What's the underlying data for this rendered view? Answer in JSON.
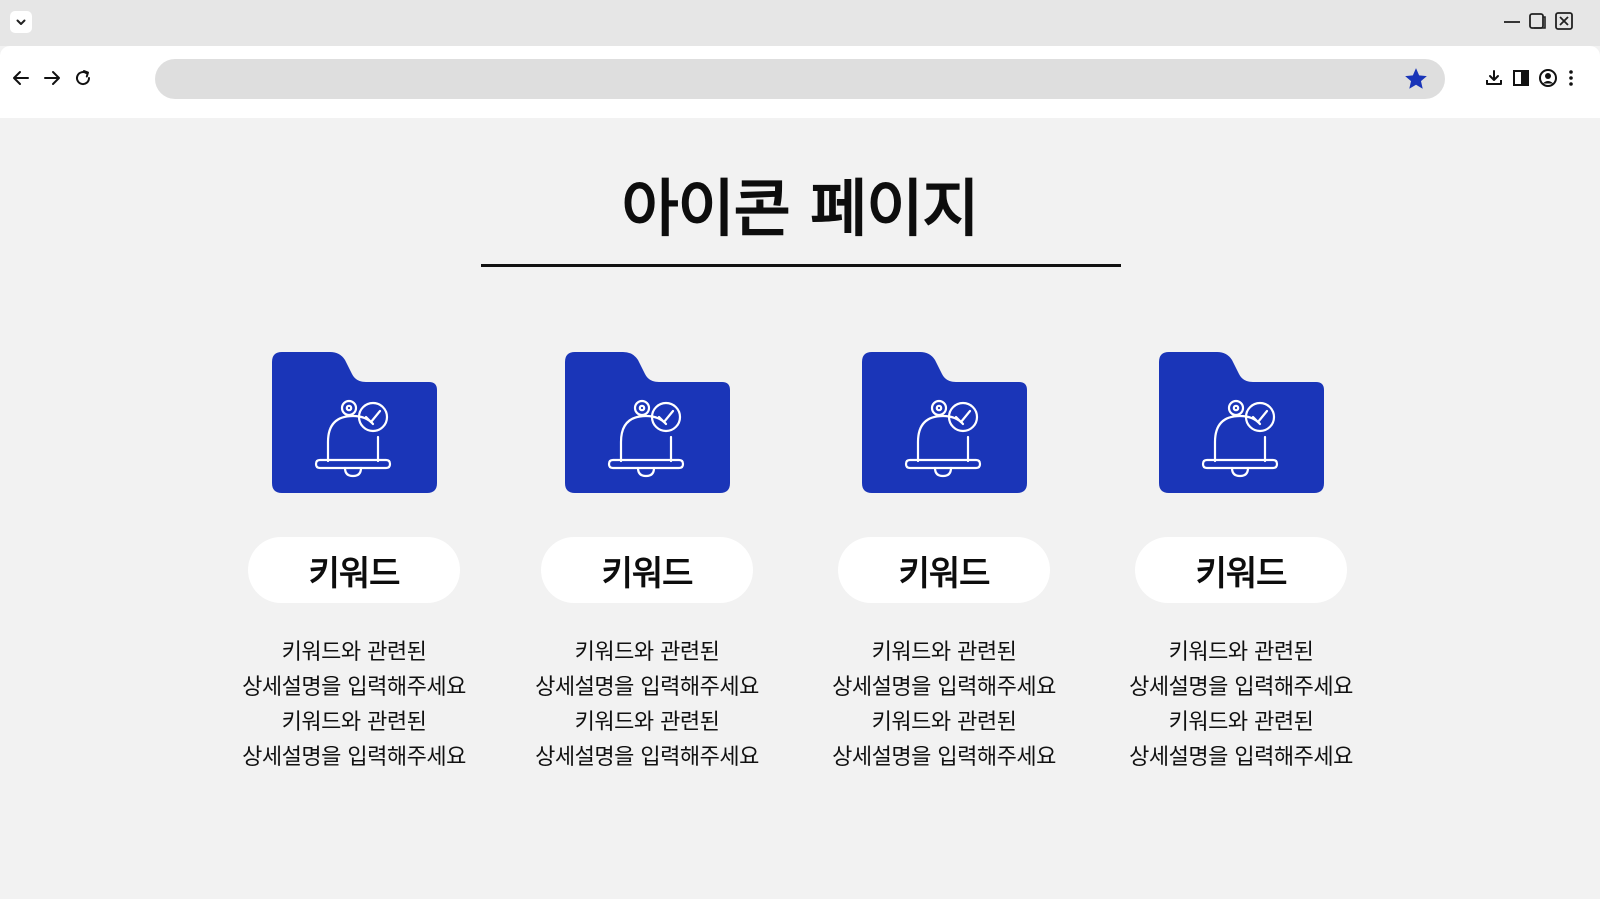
{
  "browser": {
    "address_value": "",
    "icons": [
      "chevron-down-icon",
      "minimize-icon",
      "restore-icon",
      "close-icon",
      "back-arrow-icon",
      "forward-arrow-icon",
      "reload-icon",
      "star-icon",
      "download-icon",
      "sidebar-icon",
      "profile-icon",
      "more-vertical-icon"
    ],
    "accent_color": "#1a35b8"
  },
  "page": {
    "title": "아이콘 페이지"
  },
  "cards": [
    {
      "keyword": "키워드",
      "lines": [
        "키워드와 관련된",
        "상세설명을 입력해주세요",
        "키워드와 관련된",
        "상세설명을 입력해주세요"
      ]
    },
    {
      "keyword": "키워드",
      "lines": [
        "키워드와 관련된",
        "상세설명을 입력해주세요",
        "키워드와 관련된",
        "상세설명을 입력해주세요"
      ]
    },
    {
      "keyword": "키워드",
      "lines": [
        "키워드와 관련된",
        "상세설명을 입력해주세요",
        "키워드와 관련된",
        "상세설명을 입력해주세요"
      ]
    },
    {
      "keyword": "키워드",
      "lines": [
        "키워드와 관련된",
        "상세설명을 입력해주세요",
        "키워드와 관련된",
        "상세설명을 입력해주세요"
      ]
    }
  ],
  "colors": {
    "folder": "#1a35b8",
    "background": "#f2f2f2",
    "pill": "#ffffff"
  }
}
